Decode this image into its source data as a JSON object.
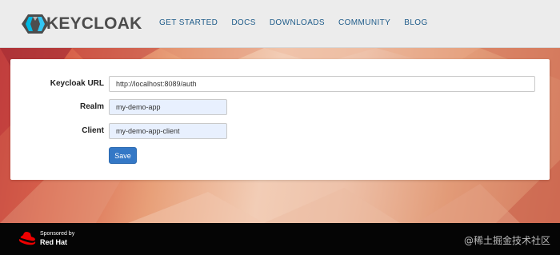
{
  "header": {
    "brand": "KEYCLOAK",
    "nav": [
      "GET STARTED",
      "DOCS",
      "DOWNLOADS",
      "COMMUNITY",
      "BLOG"
    ]
  },
  "form": {
    "url": {
      "label": "Keycloak URL",
      "value": "http://localhost:8089/auth"
    },
    "realm": {
      "label": "Realm",
      "value": "my-demo-app"
    },
    "client": {
      "label": "Client",
      "value": "my-demo-app-client"
    },
    "save_label": "Save"
  },
  "footer": {
    "sponsored_by": "Sponsored by",
    "sponsor_name": "Red Hat",
    "watermark": "@稀土掘金技术社区"
  },
  "colors": {
    "nav_link": "#1f5c8a",
    "button": "#3478c6",
    "input_autofill": "#e8f0fe",
    "redhat": "#ee0000"
  },
  "icons": {
    "logo": "keycloak-logo-icon",
    "sponsor": "redhat-hat-icon"
  }
}
